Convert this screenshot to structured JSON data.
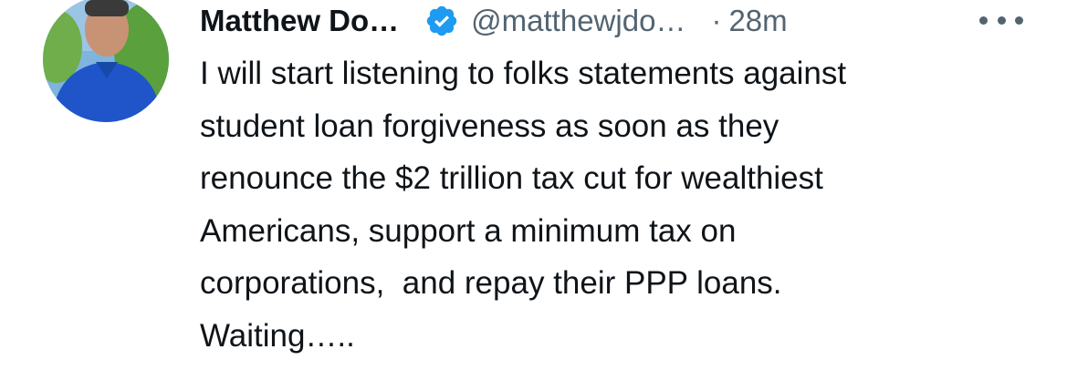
{
  "tweet": {
    "author_name": "Matthew Do…",
    "handle": "@matthewjdo…",
    "separator": "·",
    "time": "28m",
    "more_icon": "more-horizontal-icon",
    "verified_icon": "verified-badge-icon",
    "verified_color": "#1d9bf0",
    "text_lines": [
      "I will start listening to folks statements against",
      "student loan forgiveness as soon as they",
      "renounce the $2 trillion tax cut for wealthiest",
      "Americans, support a minimum tax on",
      "corporations,  and repay their PPP loans.",
      "Waiting….."
    ]
  }
}
